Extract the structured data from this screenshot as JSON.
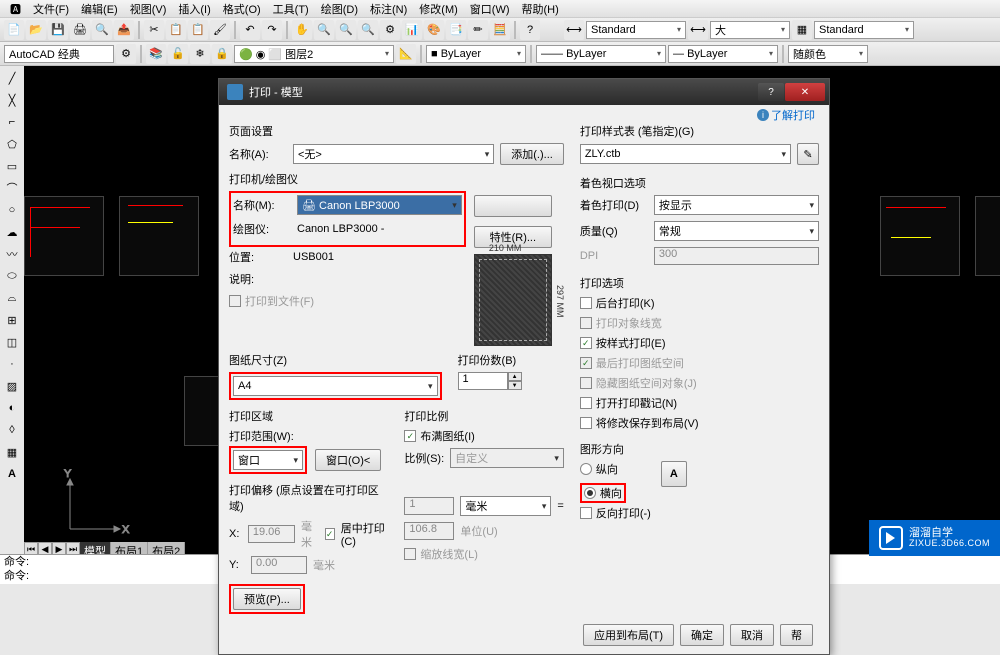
{
  "menubar": [
    "文件(F)",
    "编辑(E)",
    "视图(V)",
    "插入(I)",
    "格式(O)",
    "工具(T)",
    "绘图(D)",
    "标注(N)",
    "修改(M)",
    "窗口(W)",
    "帮助(H)"
  ],
  "workspace": "AutoCAD 经典",
  "toolbar2": {
    "layer": "图层2",
    "bylayer": "ByLayer",
    "standard": "Standard",
    "da": "大",
    "color_combo": "■ ByLayer",
    "random_color": "随颜色"
  },
  "bottom_tabs": {
    "model": "模型",
    "layout1": "布局1",
    "layout2": "布局2"
  },
  "cmdline": {
    "line1": "命令:",
    "line2": "命令:"
  },
  "dialog": {
    "title": "打印 - 模型",
    "info_link": "了解打印",
    "page_setup": {
      "label": "页面设置",
      "name": "名称(A):",
      "value": "<无>",
      "add_btn": "添加(.)..."
    },
    "printer": {
      "label": "打印机/绘图仪",
      "name": "名称(M):",
      "value": "Canon LBP3000",
      "props_btn": "特性(R)...",
      "plotter": "绘图仪:",
      "plotter_val": "Canon LBP3000 -",
      "location": "位置:",
      "location_val": "USB001",
      "desc": "说明:",
      "to_file": "打印到文件(F)",
      "paper_w": "210 MM",
      "paper_h": "297 MM"
    },
    "paper": {
      "label": "图纸尺寸(Z)",
      "value": "A4"
    },
    "copies": {
      "label": "打印份数(B)",
      "value": "1"
    },
    "area": {
      "label": "打印区域",
      "scope": "打印范围(W):",
      "value": "窗口",
      "window_btn": "窗口(O)<"
    },
    "scale": {
      "label": "打印比例",
      "fit": "布满图纸(I)",
      "ratio": "比例(S):",
      "ratio_val": "自定义",
      "unit_val": "1",
      "unit_combo": "毫米",
      "equals": "=",
      "drawing_val": "106.8",
      "drawing_unit": "单位(U)",
      "scale_lw": "缩放线宽(L)"
    },
    "offset": {
      "label": "打印偏移 (原点设置在可打印区域)",
      "x": "X:",
      "x_val": "19.06",
      "y": "Y:",
      "y_val": "0.00",
      "unit": "毫米",
      "center": "居中打印(C)"
    },
    "preview_btn": "预览(P)...",
    "style_table": {
      "label": "打印样式表 (笔指定)(G)",
      "value": "ZLY.ctb"
    },
    "shade": {
      "label": "着色视口选项",
      "shade_print": "着色打印(D)",
      "shade_val": "按显示",
      "quality": "质量(Q)",
      "quality_val": "常规",
      "dpi": "DPI",
      "dpi_val": "300"
    },
    "options": {
      "label": "打印选项",
      "background": "后台打印(K)",
      "lineweights": "打印对象线宽",
      "styles": "按样式打印(E)",
      "last": "最后打印图纸空间",
      "hide": "隐藏图纸空间对象(J)",
      "stamp": "打开打印戳记(N)",
      "save": "将修改保存到布局(V)"
    },
    "orientation": {
      "label": "图形方向",
      "portrait": "纵向",
      "landscape": "横向",
      "upside": "反向打印(-)"
    },
    "buttons": {
      "apply": "应用到布局(T)",
      "ok": "确定",
      "cancel": "取消",
      "help": "帮"
    }
  },
  "watermark": {
    "name": "溜溜自学",
    "url": "ZIXUE.3D66.COM"
  }
}
